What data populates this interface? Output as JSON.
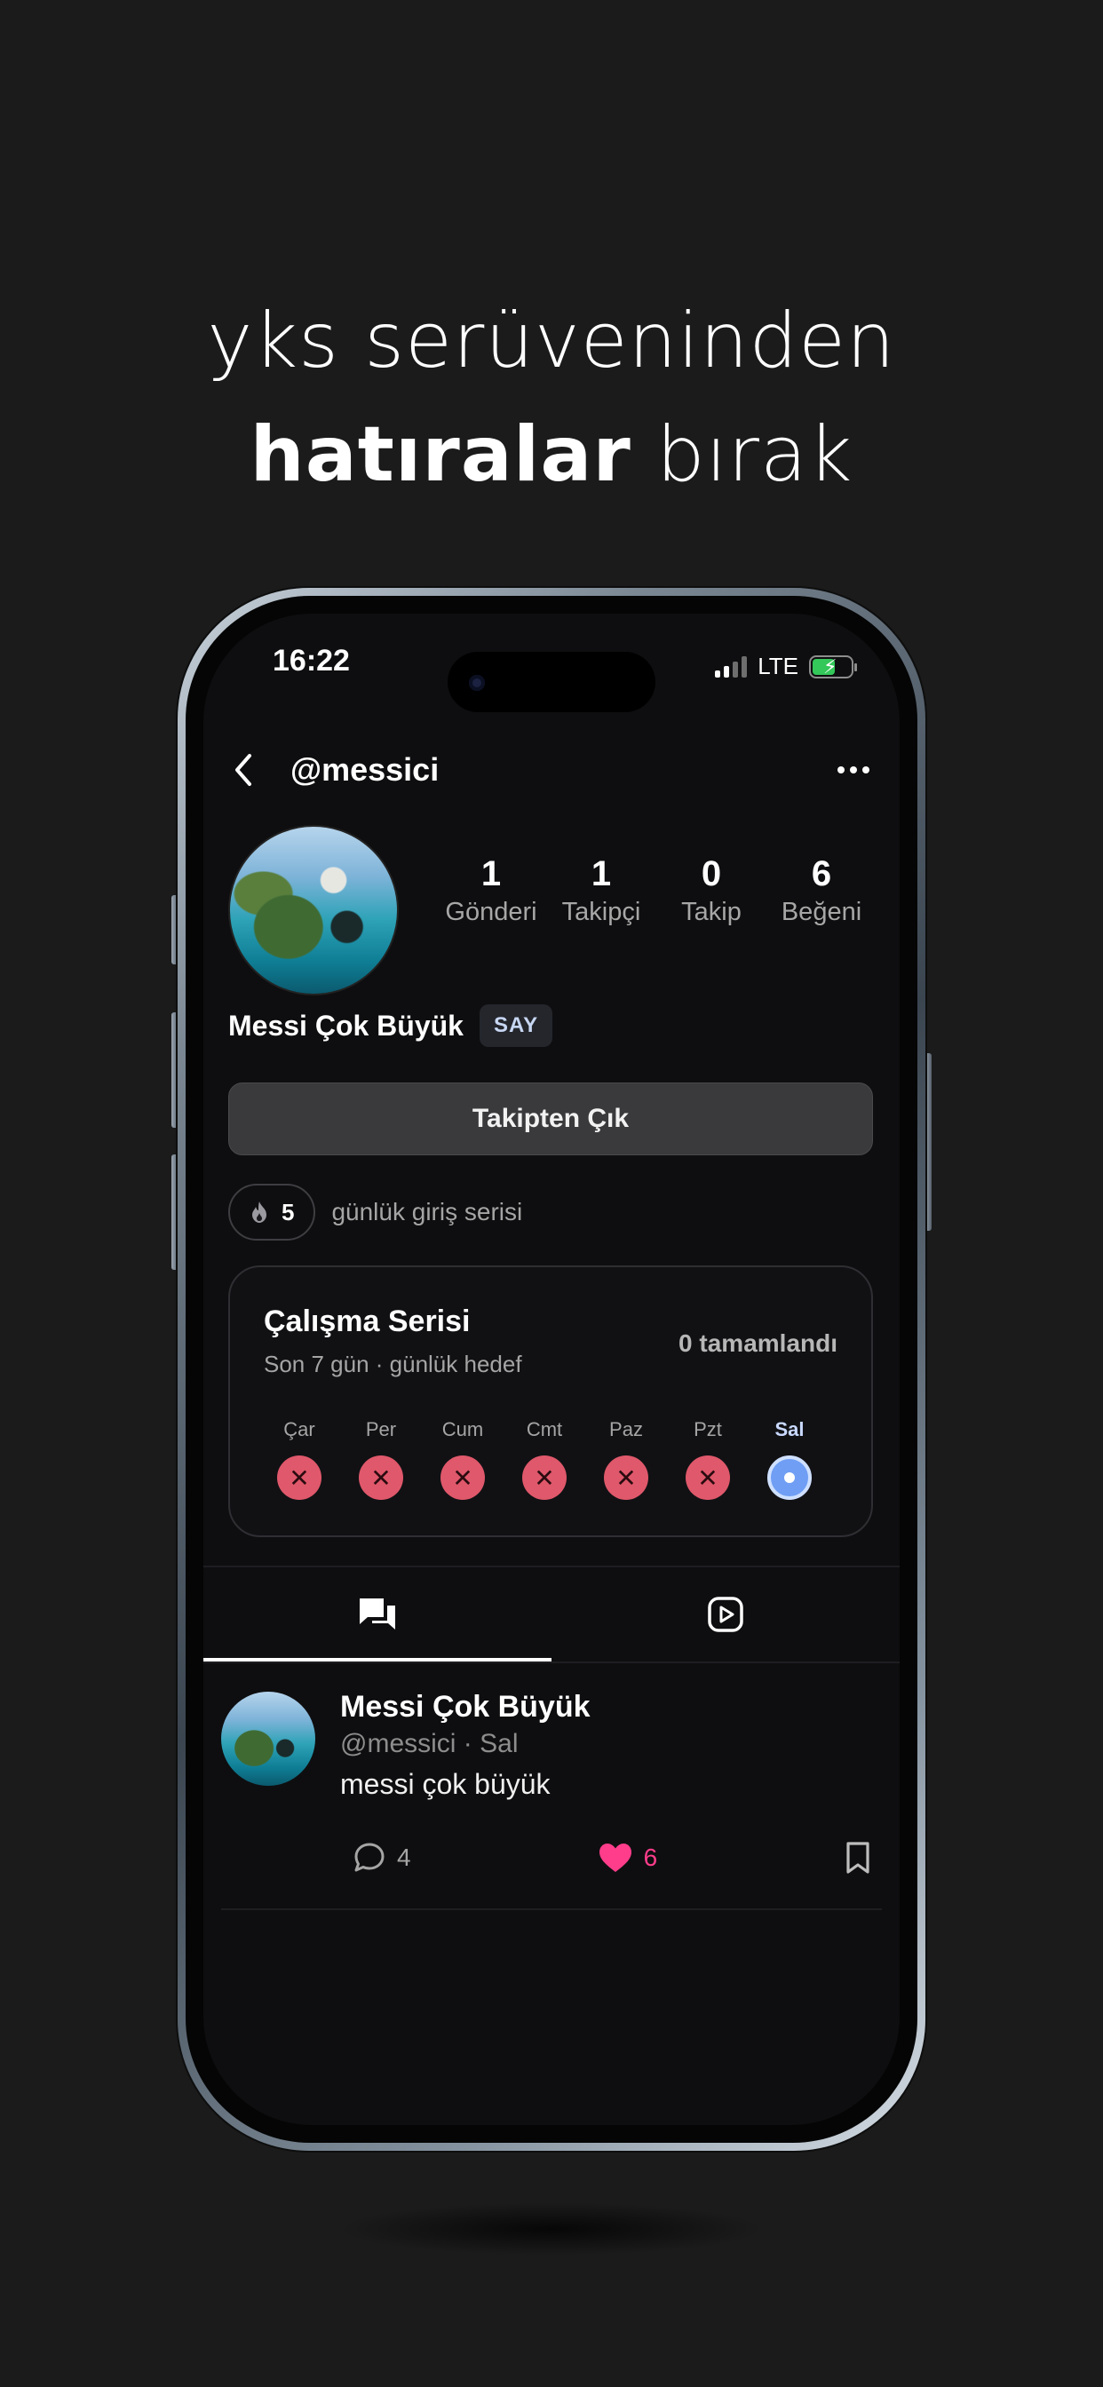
{
  "headline": {
    "line1": "yks serüveninden",
    "line2_bold": "hatıralar",
    "line2_rest": " bırak"
  },
  "status_bar": {
    "time": "16:22",
    "network": "LTE"
  },
  "header": {
    "username": "@messici"
  },
  "profile": {
    "stats": [
      {
        "value": "1",
        "label": "Gönderi"
      },
      {
        "value": "1",
        "label": "Takipçi"
      },
      {
        "value": "0",
        "label": "Takip"
      },
      {
        "value": "6",
        "label": "Beğeni"
      }
    ],
    "display_name": "Messi Çok Büyük",
    "badge": "SAY",
    "unfollow_label": "Takipten Çık",
    "streak": {
      "count": "5",
      "text": "günlük giriş serisi"
    }
  },
  "study_card": {
    "title": "Çalışma Serisi",
    "subtitle": "Son 7 gün · günlük hedef",
    "completed": "0 tamamlandı",
    "days": [
      {
        "label": "Çar",
        "status": "missed"
      },
      {
        "label": "Per",
        "status": "missed"
      },
      {
        "label": "Cum",
        "status": "missed"
      },
      {
        "label": "Cmt",
        "status": "missed"
      },
      {
        "label": "Paz",
        "status": "missed"
      },
      {
        "label": "Pzt",
        "status": "missed"
      },
      {
        "label": "Sal",
        "status": "today"
      }
    ]
  },
  "tabs": [
    {
      "icon": "posts-chat-icon",
      "active": true
    },
    {
      "icon": "video-play-icon",
      "active": false
    }
  ],
  "post": {
    "author": "Messi Çok Büyük",
    "meta": "@messici · Sal",
    "text": "messi çok büyük",
    "comments": "4",
    "likes": "6"
  },
  "colors": {
    "background": "#1b1b1b",
    "screen": "#0e0e10",
    "missed": "#e0586b",
    "today": "#6f9ef4",
    "like": "#ff3d8b"
  }
}
